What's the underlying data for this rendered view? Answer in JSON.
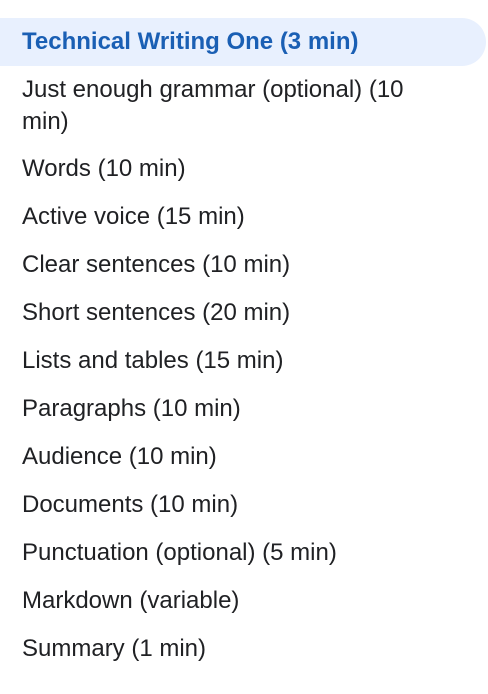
{
  "nav": {
    "items": [
      {
        "label": "Technical Writing One (3 min)"
      },
      {
        "label": "Just enough grammar (optional) (10 min)"
      },
      {
        "label": "Words (10 min)"
      },
      {
        "label": "Active voice (15 min)"
      },
      {
        "label": "Clear sentences (10 min)"
      },
      {
        "label": "Short sentences (20 min)"
      },
      {
        "label": "Lists and tables (15 min)"
      },
      {
        "label": "Paragraphs (10 min)"
      },
      {
        "label": "Audience (10 min)"
      },
      {
        "label": "Documents (10 min)"
      },
      {
        "label": "Punctuation (optional) (5 min)"
      },
      {
        "label": "Markdown (variable)"
      },
      {
        "label": "Summary (1 min)"
      }
    ]
  },
  "colors": {
    "active_text": "#1a5fb4",
    "active_background": "#e8f0fe",
    "text": "#202124"
  }
}
